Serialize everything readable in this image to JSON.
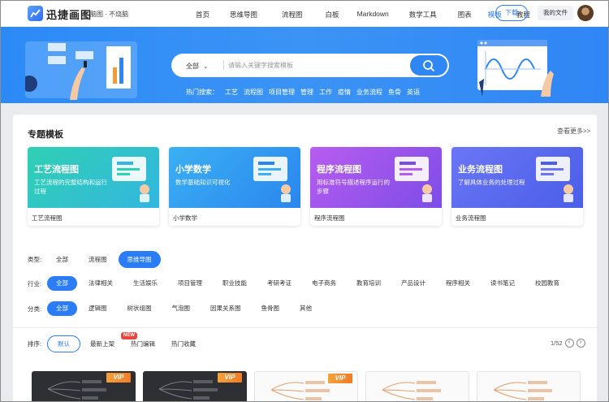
{
  "header": {
    "brand": "迅捷画图",
    "slogan": "脑图 · 不烧脑",
    "nav": [
      {
        "label": "首页",
        "active": false
      },
      {
        "label": "思维导图",
        "active": false
      },
      {
        "label": "流程图",
        "active": false
      },
      {
        "label": "白板",
        "active": false
      },
      {
        "label": "Markdown",
        "active": false
      },
      {
        "label": "数学工具",
        "active": false
      },
      {
        "label": "图表",
        "active": false
      },
      {
        "label": "模板",
        "active": true
      },
      {
        "label": "教程",
        "active": false
      }
    ],
    "download_label": "下载",
    "myfiles_label": "我的文件"
  },
  "search": {
    "scope": "全部",
    "placeholder": "请输入关键字搜索模板",
    "hot_label": "热门搜索：",
    "hot_terms": [
      "工艺",
      "流程图",
      "项目管理",
      "管理",
      "工作",
      "疫情",
      "业务流程",
      "鱼骨",
      "英语"
    ]
  },
  "featured": {
    "title": "专题模板",
    "see_more": "查看更多>>",
    "cards": [
      {
        "title": "工艺流程图",
        "desc": "工艺流程的完整结构和运行过程",
        "label": "工艺流程图",
        "color1": "#2fd0b3",
        "color2": "#33b6e0"
      },
      {
        "title": "小学数学",
        "desc": "数学基础知识可视化",
        "label": "小学数学",
        "color1": "#3bb0f3",
        "color2": "#2a86ee"
      },
      {
        "title": "程序流程图",
        "desc": "用标准符号描述程序运行的步骤",
        "label": "程序流程图",
        "color1": "#b85cf0",
        "color2": "#7c4de6"
      },
      {
        "title": "业务流程图",
        "desc": "了解具体业务的处理过程",
        "label": "业务流程图",
        "color1": "#6a76f5",
        "color2": "#4a5ee8"
      }
    ]
  },
  "filters": {
    "type": {
      "label": "类型:",
      "options": [
        "全部",
        "流程图",
        "思维导图"
      ],
      "selected": "思维导图"
    },
    "industry": {
      "label": "行业:",
      "options": [
        "全部",
        "法律相关",
        "生活娱乐",
        "项目管理",
        "职业技能",
        "考研考证",
        "电子商务",
        "教育培训",
        "产品设计",
        "程序相关",
        "读书笔记",
        "校园教育"
      ],
      "selected": "全部"
    },
    "category": {
      "label": "分类:",
      "options": [
        "全部",
        "逻辑图",
        "树状组图",
        "气泡图",
        "因果关系图",
        "鱼骨图",
        "其他"
      ],
      "selected": "全部"
    }
  },
  "sort": {
    "label": "排序:",
    "options": [
      "默认",
      "最新上架",
      "热门编辑",
      "热门收藏"
    ],
    "selected": "默认",
    "new_badge": "NEW",
    "page": "1/52"
  },
  "thumbnails": [
    {
      "theme": "dark",
      "vip": "VIP"
    },
    {
      "theme": "dark",
      "vip": "VIP"
    },
    {
      "theme": "light",
      "vip": "VIP"
    },
    {
      "theme": "light",
      "vip": ""
    },
    {
      "theme": "light",
      "vip": ""
    }
  ],
  "colors": {
    "accent": "#2a7cf7",
    "banner": "#2f86f5",
    "vip": "#f28c2f",
    "badge": "#e8453c"
  }
}
